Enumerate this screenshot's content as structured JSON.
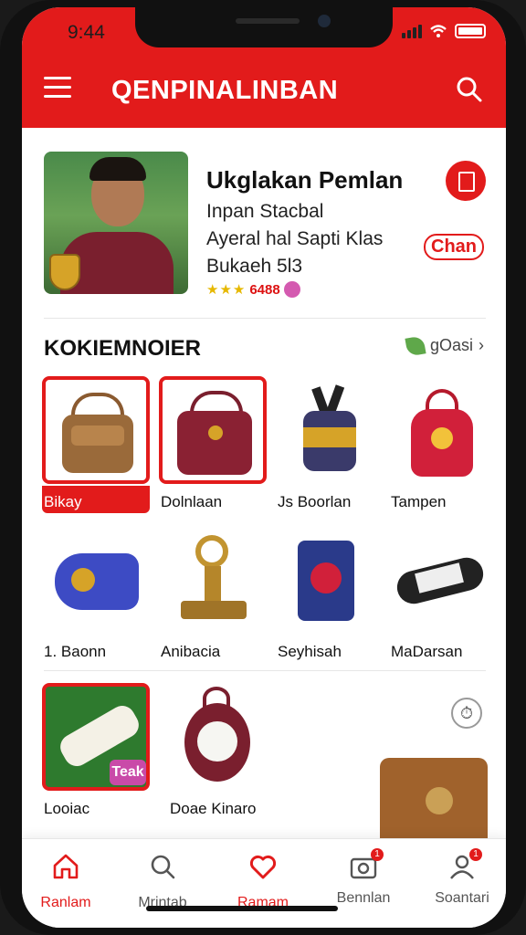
{
  "status": {
    "time": "9:44"
  },
  "appbar": {
    "title": "QENPINALINBAN"
  },
  "profile": {
    "name": "Ukglakan Pemlan",
    "line1": "Inpan Stacbal",
    "line2": "Ayeral hal Sapti Klas",
    "line3": "Bukaeh 5l3",
    "stars": "★★★",
    "rating_count": "6488",
    "tag": "Chan"
  },
  "section": {
    "title": "KOKIEMNOIER",
    "more_label": "gOasi"
  },
  "grid": [
    {
      "label": "Bikay"
    },
    {
      "label": "Dolnlaan"
    },
    {
      "label": "Js Boorlan"
    },
    {
      "label": "Tampen"
    },
    {
      "label": "1. Baonn"
    },
    {
      "label": "Anibacia"
    },
    {
      "label": "Seyhisah"
    },
    {
      "label": "MaDarsan"
    },
    {
      "label": "Looiac"
    },
    {
      "label": "Doae Kinaro"
    }
  ],
  "promo_label": "Teak",
  "nav": [
    {
      "label": "Ranlam",
      "icon": "home-icon"
    },
    {
      "label": "Mrintab",
      "icon": "search-icon"
    },
    {
      "label": "Ramam",
      "icon": "heart-icon"
    },
    {
      "label": "Bennlan",
      "icon": "camera-icon"
    },
    {
      "label": "Soantari",
      "icon": "profile-icon"
    }
  ],
  "colors": {
    "accent": "#e21b1b"
  }
}
